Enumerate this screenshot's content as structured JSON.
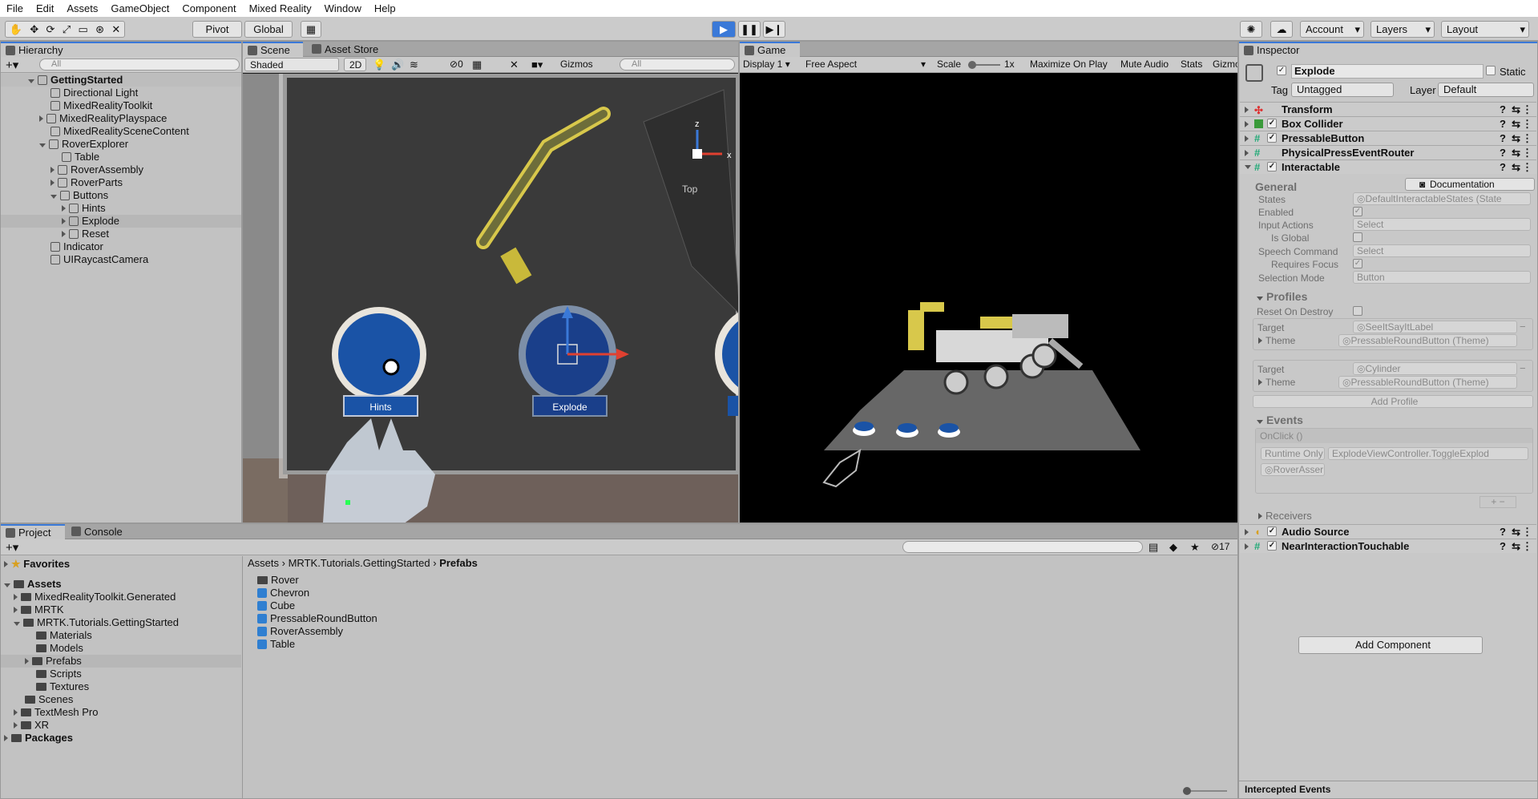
{
  "menu": [
    "File",
    "Edit",
    "Assets",
    "GameObject",
    "Component",
    "Mixed Reality",
    "Window",
    "Help"
  ],
  "toolbar": {
    "pivot": "Pivot",
    "global": "Global",
    "account": "Account",
    "layers": "Layers",
    "layout": "Layout"
  },
  "hierarchy": {
    "tab": "Hierarchy",
    "search": "All",
    "root": "GettingStarted",
    "items": [
      "Directional Light",
      "MixedRealityToolkit",
      "MixedRealityPlayspace",
      "MixedRealitySceneContent",
      "RoverExplorer",
      "Table",
      "RoverAssembly",
      "RoverParts",
      "Buttons",
      "Hints",
      "Explode",
      "Reset",
      "Indicator",
      "UIRaycastCamera"
    ]
  },
  "scene": {
    "tab_scene": "Scene",
    "tab_store": "Asset Store",
    "shading": "Shaded",
    "mode_2d": "2D",
    "hidden_count": "0",
    "gizmos": "Gizmos",
    "search": "All",
    "axis_x": "x",
    "axis_z": "z",
    "view": "Top",
    "btn_hints": "Hints",
    "btn_explode": "Explode"
  },
  "game": {
    "tab": "Game",
    "display": "Display 1",
    "aspect": "Free Aspect",
    "scale_label": "Scale",
    "scale_value": "1x",
    "maximize": "Maximize On Play",
    "mute": "Mute Audio",
    "stats": "Stats",
    "gizmos": "Gizmos"
  },
  "project": {
    "tab_project": "Project",
    "tab_console": "Console",
    "hidden_count": "17",
    "favorites": "Favorites",
    "assets": "Assets",
    "packages": "Packages",
    "folders": [
      "MixedRealityToolkit.Generated",
      "MRTK",
      "MRTK.Tutorials.GettingStarted",
      "Materials",
      "Models",
      "Prefabs",
      "Scripts",
      "Textures",
      "Scenes",
      "TextMesh Pro",
      "XR"
    ],
    "breadcrumb": [
      "Assets",
      "MRTK.Tutorials.GettingStarted",
      "Prefabs"
    ],
    "files": [
      "Rover",
      "Chevron",
      "Cube",
      "PressableRoundButton",
      "RoverAssembly",
      "Table"
    ]
  },
  "inspector": {
    "tab": "Inspector",
    "object_name": "Explode",
    "static": "Static",
    "tag_label": "Tag",
    "tag": "Untagged",
    "layer_label": "Layer",
    "layer": "Default",
    "components": [
      "Transform",
      "Box Collider",
      "PressableButton",
      "PhysicalPressEventRouter",
      "Interactable"
    ],
    "general": "General",
    "documentation": "Documentation",
    "states_label": "States",
    "states_value": "DefaultInteractableStates (State",
    "enabled_label": "Enabled",
    "input_actions_label": "Input Actions",
    "input_actions_value": "Select",
    "is_global_label": "Is Global",
    "speech_label": "Speech Command",
    "speech_value": "Select",
    "requires_focus_label": "Requires Focus",
    "selection_mode_label": "Selection Mode",
    "selection_mode_value": "Button",
    "profiles": "Profiles",
    "reset_on_destroy": "Reset On Destroy",
    "target_label": "Target",
    "target1": "SeeItSayItLabel",
    "theme_label": "Theme",
    "theme1": "PressableRoundButton (Theme)",
    "target2": "Cylinder",
    "theme2": "PressableRoundButton (Theme)",
    "add_profile": "Add Profile",
    "events": "Events",
    "onclick": "OnClick ()",
    "runtime": "Runtime Only",
    "function": "ExplodeViewController.ToggleExplod",
    "object_ref": "RoverAsser",
    "receivers": "Receivers",
    "audio_source": "Audio Source",
    "near_touchable": "NearInteractionTouchable",
    "add_component": "Add Component",
    "footer": "Intercepted Events"
  }
}
